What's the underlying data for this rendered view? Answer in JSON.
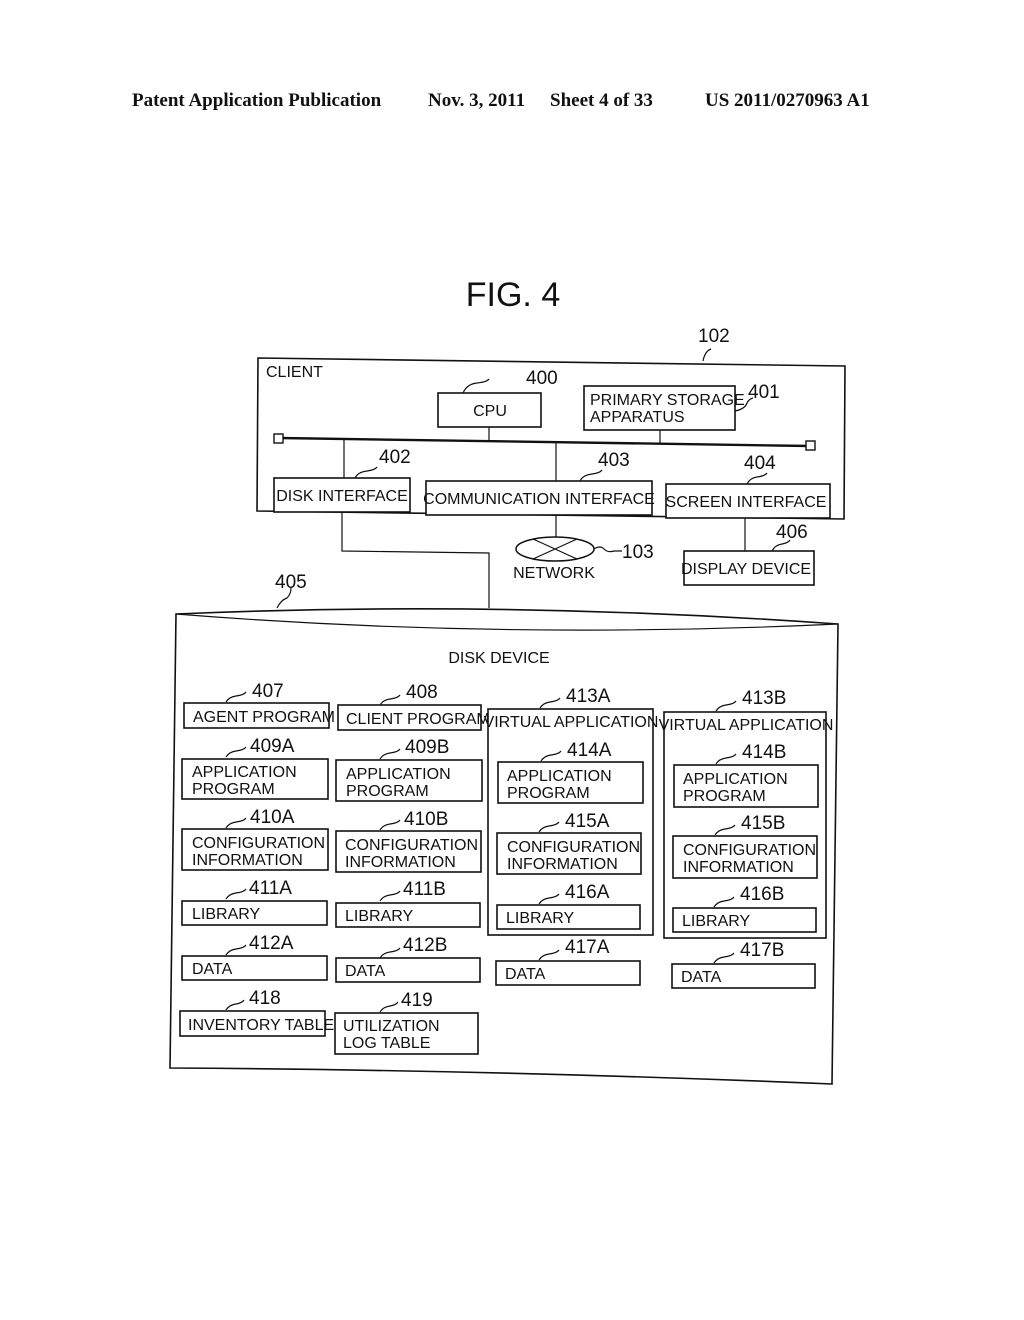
{
  "header": {
    "publication": "Patent Application Publication",
    "date": "Nov. 3, 2011",
    "sheet": "Sheet 4 of 33",
    "number": "US 2011/0270963 A1"
  },
  "figure": {
    "title": "FIG. 4",
    "client": {
      "ref": "102",
      "label": "CLIENT"
    },
    "cpu": {
      "ref": "400",
      "label": "CPU"
    },
    "primary_storage": {
      "ref": "401",
      "line1": "PRIMARY STORAGE",
      "line2": "APPARATUS"
    },
    "disk_interface": {
      "ref": "402",
      "label": "DISK INTERFACE"
    },
    "communication_interface": {
      "ref": "403",
      "label": "COMMUNICATION INTERFACE"
    },
    "screen_interface": {
      "ref": "404",
      "label": "SCREEN INTERFACE"
    },
    "network": {
      "ref": "103",
      "label": "NETWORK"
    },
    "display_device": {
      "ref": "406",
      "label": "DISPLAY DEVICE"
    },
    "disk_device": {
      "ref": "405",
      "label": "DISK DEVICE"
    },
    "col1": {
      "agent": {
        "ref": "407",
        "label": "AGENT PROGRAM"
      },
      "app": {
        "ref": "409A",
        "line1": "APPLICATION",
        "line2": "PROGRAM"
      },
      "config": {
        "ref": "410A",
        "line1": "CONFIGURATION",
        "line2": "INFORMATION"
      },
      "library": {
        "ref": "411A",
        "label": "LIBRARY"
      },
      "data": {
        "ref": "412A",
        "label": "DATA"
      },
      "inventory": {
        "ref": "418",
        "label": "INVENTORY TABLE"
      }
    },
    "col2": {
      "client_program": {
        "ref": "408",
        "label": "CLIENT PROGRAM"
      },
      "app": {
        "ref": "409B",
        "line1": "APPLICATION",
        "line2": "PROGRAM"
      },
      "config": {
        "ref": "410B",
        "line1": "CONFIGURATION",
        "line2": "INFORMATION"
      },
      "library": {
        "ref": "411B",
        "label": "LIBRARY"
      },
      "data": {
        "ref": "412B",
        "label": "DATA"
      },
      "utilization": {
        "ref": "419",
        "line1": "UTILIZATION",
        "line2": "LOG TABLE"
      }
    },
    "vapp_a": {
      "ref": "413A",
      "label": "VIRTUAL APPLICATION",
      "app": {
        "ref": "414A",
        "line1": "APPLICATION",
        "line2": "PROGRAM"
      },
      "config": {
        "ref": "415A",
        "line1": "CONFIGURATION",
        "line2": "INFORMATION"
      },
      "library": {
        "ref": "416A",
        "label": "LIBRARY"
      },
      "data": {
        "ref": "417A",
        "label": "DATA"
      }
    },
    "vapp_b": {
      "ref": "413B",
      "label": "VIRTUAL APPLICATION",
      "app": {
        "ref": "414B",
        "line1": "APPLICATION",
        "line2": "PROGRAM"
      },
      "config": {
        "ref": "415B",
        "line1": "CONFIGURATION",
        "line2": "INFORMATION"
      },
      "library": {
        "ref": "416B",
        "label": "LIBRARY"
      },
      "data": {
        "ref": "417B",
        "label": "DATA"
      }
    }
  }
}
